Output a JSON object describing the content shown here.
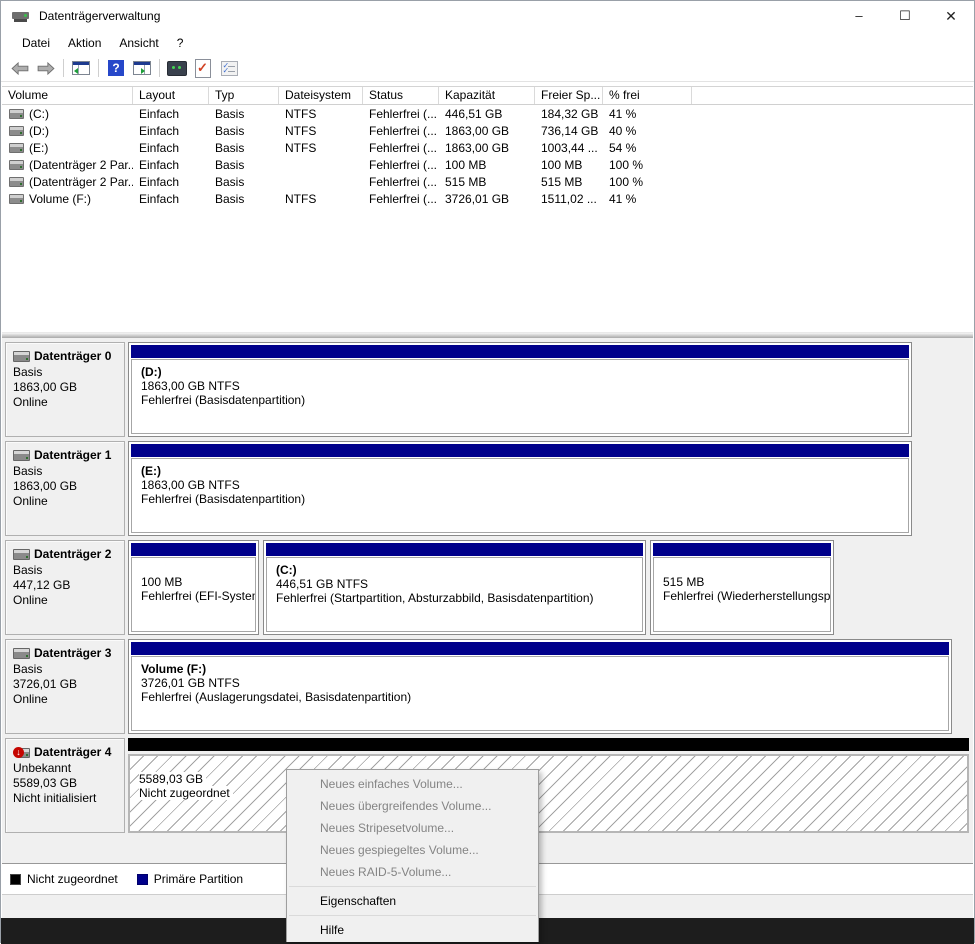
{
  "window": {
    "title": "Datenträgerverwaltung",
    "controls": {
      "minimize": "–",
      "maximize": "☐",
      "close": "✕"
    }
  },
  "menu": {
    "items": [
      "Datei",
      "Aktion",
      "Ansicht",
      "?"
    ]
  },
  "toolbar": {
    "icons": [
      "back",
      "forward",
      "show-console-tree",
      "help",
      "show-action-pane",
      "remote-screen",
      "validate-document",
      "checklist"
    ],
    "help_glyph": "?"
  },
  "table": {
    "columns": [
      "Volume",
      "Layout",
      "Typ",
      "Dateisystem",
      "Status",
      "Kapazität",
      "Freier Sp...",
      "% frei"
    ],
    "rows": [
      {
        "volume": "(C:)",
        "layout": "Einfach",
        "typ": "Basis",
        "fs": "NTFS",
        "status": "Fehlerfrei (...",
        "kapazitaet": "446,51 GB",
        "frei": "184,32 GB",
        "pct": "41 %"
      },
      {
        "volume": "(D:)",
        "layout": "Einfach",
        "typ": "Basis",
        "fs": "NTFS",
        "status": "Fehlerfrei (...",
        "kapazitaet": "1863,00 GB",
        "frei": "736,14 GB",
        "pct": "40 %"
      },
      {
        "volume": "(E:)",
        "layout": "Einfach",
        "typ": "Basis",
        "fs": "NTFS",
        "status": "Fehlerfrei (...",
        "kapazitaet": "1863,00 GB",
        "frei": "1003,44 ...",
        "pct": "54 %"
      },
      {
        "volume": "(Datenträger 2 Par...",
        "layout": "Einfach",
        "typ": "Basis",
        "fs": "",
        "status": "Fehlerfrei (...",
        "kapazitaet": "100 MB",
        "frei": "100 MB",
        "pct": "100 %"
      },
      {
        "volume": "(Datenträger 2 Par...",
        "layout": "Einfach",
        "typ": "Basis",
        "fs": "",
        "status": "Fehlerfrei (...",
        "kapazitaet": "515 MB",
        "frei": "515 MB",
        "pct": "100 %"
      },
      {
        "volume": "Volume (F:)",
        "layout": "Einfach",
        "typ": "Basis",
        "fs": "NTFS",
        "status": "Fehlerfrei (...",
        "kapazitaet": "3726,01 GB",
        "frei": "1511,02 ...",
        "pct": "41 %"
      }
    ]
  },
  "disks": [
    {
      "name": "Datenträger 0",
      "type": "Basis",
      "size": "1863,00 GB",
      "state": "Online",
      "partitions": [
        {
          "label": "(D:)",
          "detail": "1863,00 GB NTFS",
          "status": "Fehlerfrei (Basisdatenpartition)"
        }
      ]
    },
    {
      "name": "Datenträger 1",
      "type": "Basis",
      "size": "1863,00 GB",
      "state": "Online",
      "partitions": [
        {
          "label": "(E:)",
          "detail": "1863,00 GB NTFS",
          "status": "Fehlerfrei (Basisdatenpartition)"
        }
      ]
    },
    {
      "name": "Datenträger 2",
      "type": "Basis",
      "size": "447,12 GB",
      "state": "Online",
      "partitions": [
        {
          "label": "",
          "detail": "100 MB",
          "status": "Fehlerfrei (EFI-Systemp"
        },
        {
          "label": "(C:)",
          "detail": "446,51 GB NTFS",
          "status": "Fehlerfrei (Startpartition, Absturzabbild, Basisdatenpartition)"
        },
        {
          "label": "",
          "detail": "515 MB",
          "status": "Fehlerfrei (Wiederherstellungspa"
        }
      ]
    },
    {
      "name": "Datenträger 3",
      "type": "Basis",
      "size": "3726,01 GB",
      "state": "Online",
      "partitions": [
        {
          "label": "Volume  (F:)",
          "detail": "3726,01 GB NTFS",
          "status": "Fehlerfrei (Auslagerungsdatei, Basisdatenpartition)"
        }
      ]
    },
    {
      "name": "Datenträger 4",
      "type": "Unbekannt",
      "size": "5589,03 GB",
      "state": "Nicht initialisiert",
      "unalloc": {
        "size": "5589,03 GB",
        "status": "Nicht zugeordnet"
      }
    }
  ],
  "context_menu": {
    "items": [
      {
        "label": "Neues einfaches Volume...",
        "enabled": false
      },
      {
        "label": "Neues übergreifendes Volume...",
        "enabled": false
      },
      {
        "label": "Neues Stripesetvolume...",
        "enabled": false
      },
      {
        "label": "Neues gespiegeltes Volume...",
        "enabled": false
      },
      {
        "label": "Neues RAID-5-Volume...",
        "enabled": false
      },
      {
        "label": "Eigenschaften",
        "enabled": true
      },
      {
        "label": "Hilfe",
        "enabled": true
      }
    ]
  },
  "legend": {
    "items": [
      {
        "label": "Nicht zugeordnet",
        "color": "#000000"
      },
      {
        "label": "Primäre Partition",
        "color": "#00008B"
      }
    ]
  },
  "colors": {
    "primary_partition": "#00008B",
    "unallocated": "#000000",
    "error_badge": "#C50500"
  }
}
